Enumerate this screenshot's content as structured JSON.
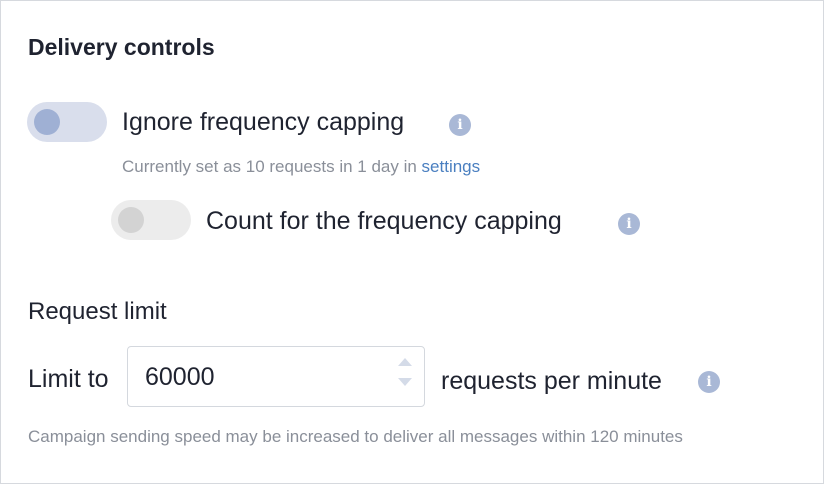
{
  "delivery": {
    "title": "Delivery controls",
    "ignore_capping": {
      "label": "Ignore frequency capping",
      "enabled": true,
      "hint_prefix": "Currently set as 10 requests in 1 day in ",
      "hint_link": "settings"
    },
    "count_capping": {
      "label": "Count for the frequency capping",
      "enabled": false
    }
  },
  "request_limit": {
    "title": "Request limit",
    "prefix_label": "Limit to",
    "value": "60000",
    "suffix_label": "requests per minute",
    "note": "Campaign sending speed may be increased to deliver all messages within 120 minutes"
  },
  "icons": {
    "info": "i"
  },
  "colors": {
    "toggle_on_track": "#d9deec",
    "toggle_on_knob": "#9fb0d4",
    "toggle_off_track": "#ececec",
    "link": "#4a7fc0",
    "info_icon": "#a9b8d6"
  }
}
